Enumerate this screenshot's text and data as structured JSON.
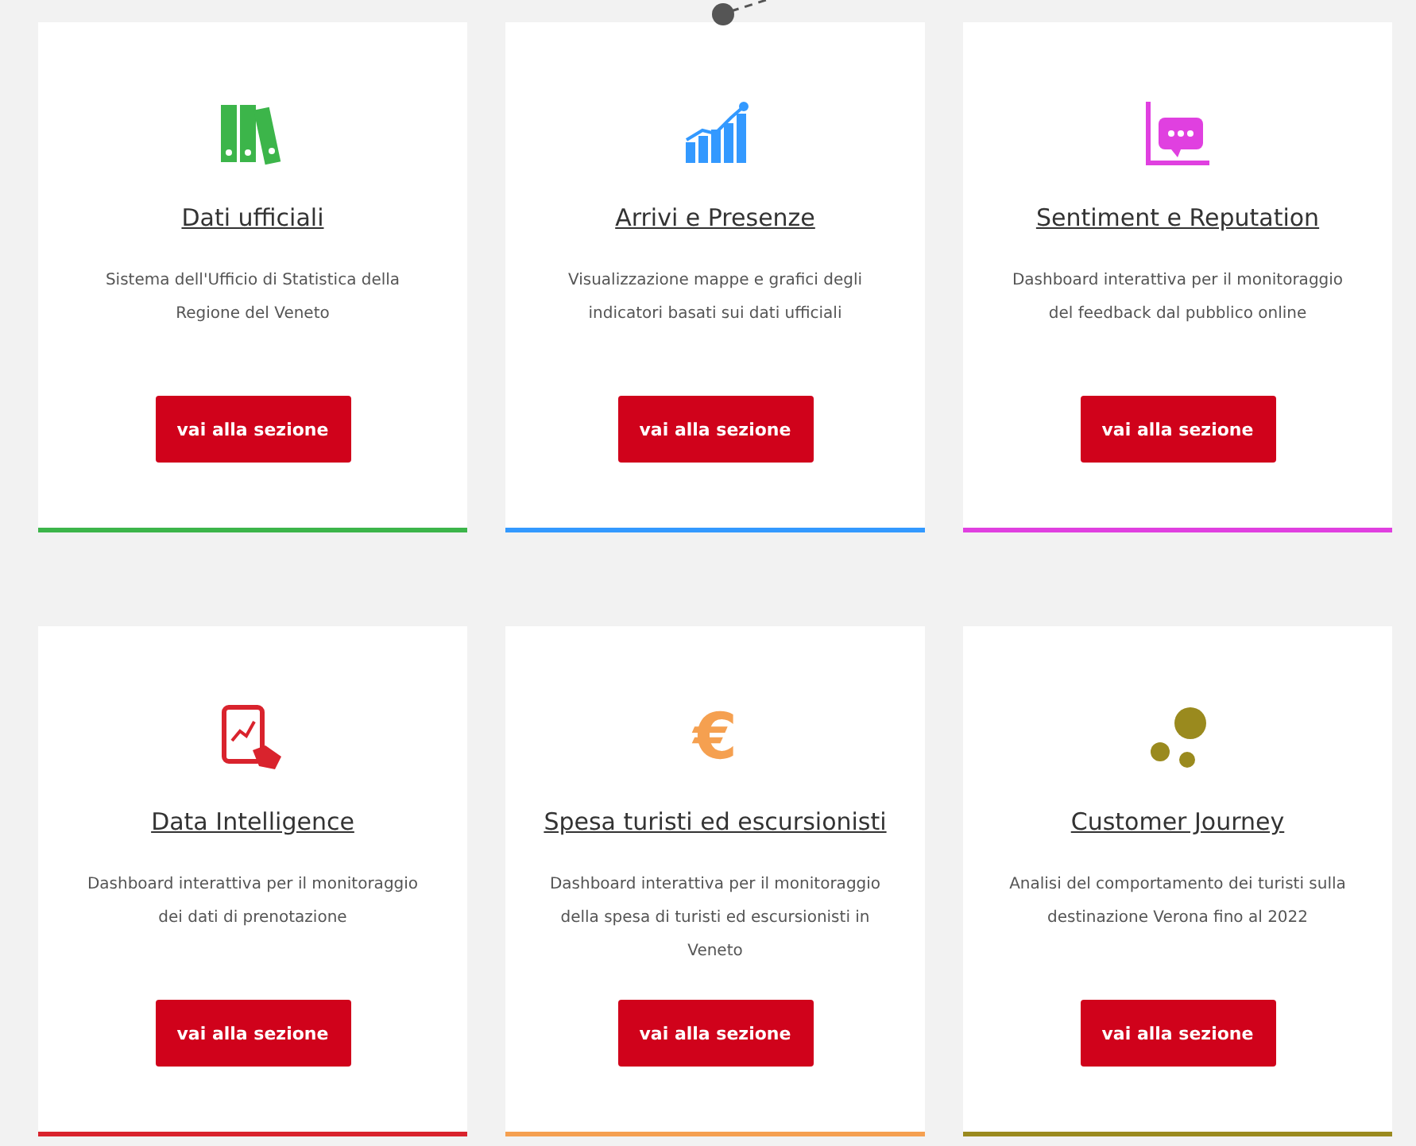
{
  "cards": [
    {
      "kind": "binders",
      "color": "#3cb54a",
      "title": "Dati ufficiali",
      "description": "Sistema dell'Ufficio di Statistica della Regione del Veneto",
      "button": "vai alla sezione"
    },
    {
      "kind": "chart",
      "color": "#3399ff",
      "title": "Arrivi e Presenze",
      "description": "Visualizzazione mappe e grafici degli indicatori basati sui dati ufficiali",
      "button": "vai alla sezione"
    },
    {
      "kind": "chat",
      "color": "#e040e0",
      "title": "Sentiment e Reputation",
      "description": "Dashboard interattiva per il monitoraggio del feedback dal pubblico online",
      "button": "vai alla sezione"
    },
    {
      "kind": "tablet",
      "color": "#d9232d",
      "title": "Data Intelligence",
      "description": "Dashboard interattiva per il monitoraggio dei dati di prenotazione",
      "button": "vai alla sezione"
    },
    {
      "kind": "glyph",
      "glyph": "€",
      "color": "#f5a050",
      "title": "Spesa turisti ed escursionisti",
      "description": "Dashboard interattiva per il monitoraggio della spesa di turisti ed escursionisti in Veneto",
      "button": "vai alla sezione"
    },
    {
      "kind": "dots",
      "color": "#9a8a1e",
      "title": "Customer Journey",
      "description": "Analisi del comportamento dei turisti sulla destinazione Verona fino al 2022",
      "button": "vai alla sezione"
    }
  ]
}
